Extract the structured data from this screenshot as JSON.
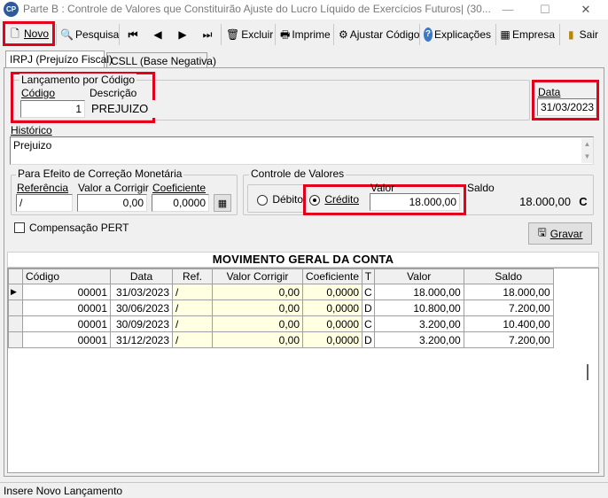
{
  "window": {
    "title": "Parte B : Controle de Valores que Constituirão Ajuste do Lucro Líquido de Exercícios Futuros| (30...",
    "icon_text": "CP",
    "minimize": "—",
    "maximize": "☐",
    "close": "✕"
  },
  "toolbar": {
    "novo": "Novo",
    "pesquisa": "Pesquisa",
    "excluir": "Excluir",
    "imprime": "Imprime",
    "ajustar": "Ajustar Código",
    "explicacoes": "Explicações",
    "empresa": "Empresa",
    "sair": "Sair"
  },
  "tabs": [
    "IRPJ (Prejuízo Fiscal)",
    "CSLL (Base Negativa)"
  ],
  "lancamento": {
    "group": "Lançamento por Código",
    "codigo_label": "Código",
    "codigo_value": "1",
    "descricao_label": "Descrição",
    "descricao_value": "PREJUIZO"
  },
  "data": {
    "label": "Data",
    "value": "31/03/2023"
  },
  "historico": {
    "label": "Histórico",
    "value": "Prejuizo"
  },
  "correcao": {
    "group": "Para Efeito de Correção Monetária",
    "referencia_label": "Referência",
    "referencia_value": "/",
    "valor_label": "Valor a Corrigir",
    "valor_value": "0,00",
    "coef_label": "Coeficiente",
    "coef_value": "0,0000"
  },
  "controle": {
    "group": "Controle de Valores",
    "debito": "Débito",
    "credito": "Crédito",
    "valor_label": "Valor",
    "valor_value": "18.000,00",
    "saldo_label": "Saldo",
    "saldo_value": "18.000,00",
    "saldo_type": "C"
  },
  "compensacao": "Compensação PERT",
  "gravar": "Gravar",
  "grid": {
    "title": "MOVIMENTO GERAL DA CONTA",
    "headers": [
      "Código",
      "Data",
      "Ref.",
      "Valor Corrigir",
      "Coeficiente",
      "T",
      "Valor",
      "Saldo"
    ],
    "rows": [
      [
        "00001",
        "31/03/2023",
        "/",
        "0,00",
        "0,0000",
        "C",
        "18.000,00",
        "18.000,00"
      ],
      [
        "00001",
        "30/06/2023",
        "/",
        "0,00",
        "0,0000",
        "D",
        "10.800,00",
        "7.200,00"
      ],
      [
        "00001",
        "30/09/2023",
        "/",
        "0,00",
        "0,0000",
        "C",
        "3.200,00",
        "10.400,00"
      ],
      [
        "00001",
        "31/12/2023",
        "/",
        "0,00",
        "0,0000",
        "D",
        "3.200,00",
        "7.200,00"
      ]
    ]
  },
  "status": "Insere Novo Lançamento"
}
